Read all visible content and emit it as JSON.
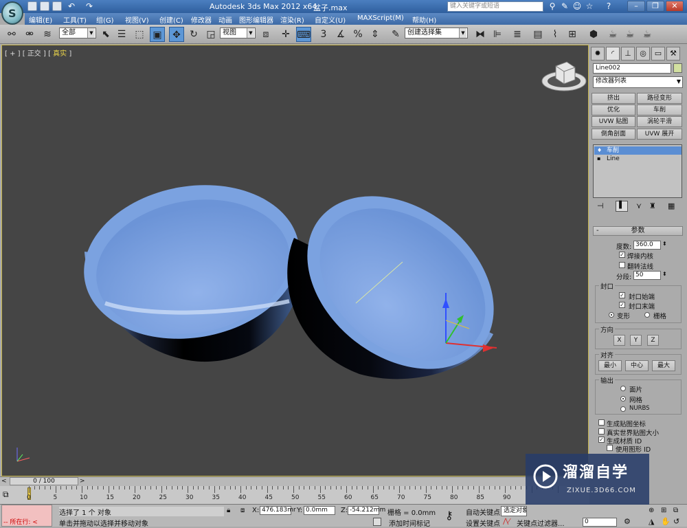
{
  "app": {
    "title": "Autodesk 3ds Max  2012 x64",
    "file": "盆子.max",
    "search_placeholder": "键入关键字或短语",
    "logo_letter": "S"
  },
  "menu": [
    "编辑(E)",
    "工具(T)",
    "组(G)",
    "视图(V)",
    "创建(C)",
    "修改器",
    "动画",
    "图形编辑器",
    "渲染(R)",
    "自定义(U)",
    "MAXScript(M)",
    "帮助(H)"
  ],
  "toolbar": {
    "filter_value": "全部",
    "refcoord_value": "视图",
    "selection_set_value": "创建选择集",
    "snap_label": "3"
  },
  "viewport": {
    "label_prefix": "[ + ] [ ",
    "view_name": "正交",
    "label_sep": " ] [ ",
    "shading": "真实",
    "label_suffix": " ]"
  },
  "panel": {
    "object_name": "Line002",
    "object_color": "#d2e0a0",
    "modifier_list": "修改器列表",
    "mod_buttons": [
      "挤出",
      "路径变形",
      "优化",
      "车削",
      "UVW 贴图",
      "涡轮平滑",
      "倒角剖面",
      "UVW 展开"
    ],
    "stack": [
      "车削",
      "Line"
    ],
    "rollout_title": "参数",
    "degrees_label": "度数:",
    "degrees_value": "360.0",
    "weld_core": "焊接内核",
    "flip_normals": "翻转法线",
    "segments_label": "分段:",
    "segments_value": "50",
    "capping_title": "封口",
    "cap_start": "封口始端",
    "cap_end": "封口末端",
    "morph": "变形",
    "grid": "栅格",
    "direction_title": "方向",
    "dir_x": "X",
    "dir_y": "Y",
    "dir_z": "Z",
    "align_title": "对齐",
    "align_min": "最小",
    "align_center": "中心",
    "align_max": "最大",
    "output_title": "输出",
    "out_patch": "面片",
    "out_mesh": "网格",
    "out_nurbs": "NURBS",
    "gen_map_coords": "生成贴图坐标",
    "real_world_map": "真实世界贴图大小",
    "gen_mat_ids": "生成材质 ID",
    "use_shape_ids": "使用图形 ID"
  },
  "timeline": {
    "frame_display": "0 / 100",
    "ticks": [
      "0",
      "5",
      "10",
      "15",
      "20",
      "25",
      "30",
      "35",
      "40",
      "45",
      "50",
      "55",
      "60",
      "65",
      "70",
      "75",
      "80",
      "85",
      "90"
    ]
  },
  "status": {
    "running_label": "所在行:",
    "selection_info": "选择了 1 个 对象",
    "prompt": "单击并拖动以选择并移动对象",
    "x_label": "X:",
    "x_value": "476.183mr",
    "y_label": "Y:",
    "y_value": "0.0mm",
    "z_label": "Z:",
    "z_value": "-54.212mm",
    "grid_label": "栅格 = 0.0mm",
    "add_time_tag": "添加时间标记",
    "auto_key": "自动关键点",
    "set_key": "设置关键点",
    "selected_value": "选定对象",
    "key_filters": "关键点过滤器...",
    "frame_value": "0"
  },
  "watermark": {
    "title": "溜溜自学",
    "subtitle": "ZIXUE.3D66.COM"
  },
  "colors": {
    "bowl": "#7fa6e2",
    "viewport_bg": "#454545",
    "selected": "#5b8ed3"
  }
}
